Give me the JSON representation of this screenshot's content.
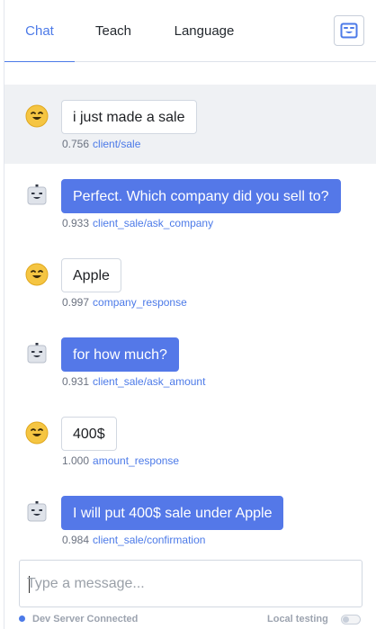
{
  "tabs": [
    {
      "label": "Chat",
      "active": true
    },
    {
      "label": "Teach",
      "active": false
    },
    {
      "label": "Language",
      "active": false
    }
  ],
  "header": {
    "toggle_icon": "bot-face-icon"
  },
  "colors": {
    "accent": "#4c7ae8",
    "bot_bubble": "#5478e8",
    "user_avatar": "#f5c542",
    "highlight_row": "#eff1f4"
  },
  "messages": [
    {
      "sender": "user",
      "avatar": "smiley-face-icon",
      "text": "i just made a sale",
      "confidence": "0.756",
      "intent": "client/sale"
    },
    {
      "sender": "bot",
      "avatar": "robot-icon",
      "text": "Perfect. Which company did you sell to?",
      "confidence": "0.933",
      "intent": "client_sale/ask_company"
    },
    {
      "sender": "user",
      "avatar": "smiley-face-icon",
      "text": "Apple",
      "confidence": "0.997",
      "intent": "company_response"
    },
    {
      "sender": "bot",
      "avatar": "robot-icon",
      "text": "for how much?",
      "confidence": "0.931",
      "intent": "client_sale/ask_amount"
    },
    {
      "sender": "user",
      "avatar": "smiley-face-icon",
      "text": "400$",
      "confidence": "1.000",
      "intent": "amount_response"
    },
    {
      "sender": "bot",
      "avatar": "robot-icon",
      "text": "I will put 400$ sale under Apple",
      "confidence": "0.984",
      "intent": "client_sale/confirmation"
    }
  ],
  "composer": {
    "placeholder": "Type a message...",
    "value": ""
  },
  "status": {
    "connection": "Dev Server Connected",
    "local_testing_label": "Local testing",
    "local_testing_enabled": false
  }
}
